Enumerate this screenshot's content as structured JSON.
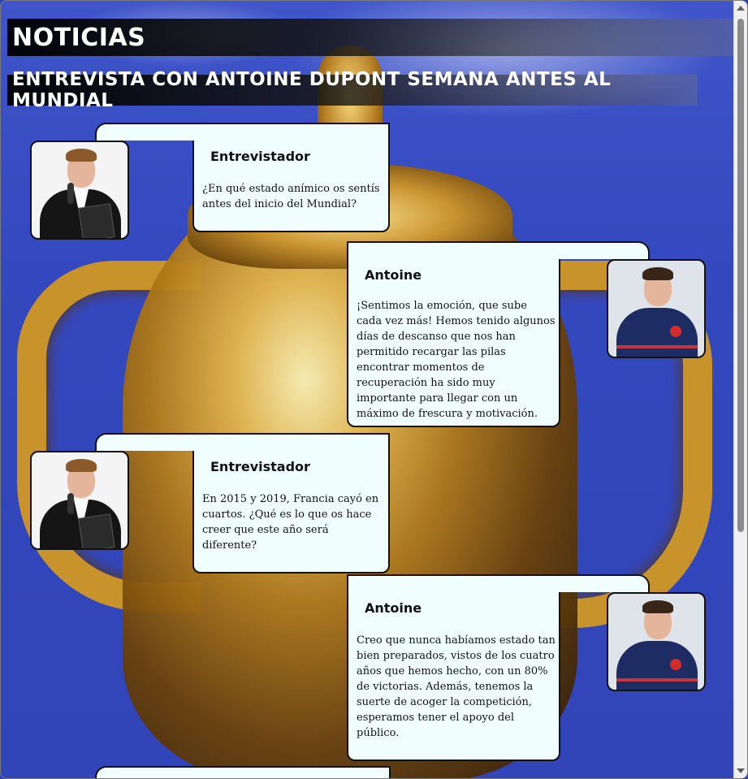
{
  "header": {
    "title": "NOTICIAS",
    "subtitle": "ENTREVISTA CON ANTOINE DUPONT SEMANA ANTES AL MUNDIAL"
  },
  "interview": [
    {
      "speaker": "Entrevistador",
      "avatar_icon": "interviewer-photo",
      "text": "¿En qué estado anímico os sentís antes del inicio del Mundial?"
    },
    {
      "speaker": "Antoine",
      "avatar_icon": "player-photo",
      "text": "¡Sentimos la emoción, que sube cada vez más! Hemos tenido algunos días de descanso que nos han permitido recargar las pilas encontrar momentos de recuperación ha sido muy importante para llegar con un máximo de frescura y motivación."
    },
    {
      "speaker": "Entrevistador",
      "avatar_icon": "interviewer-photo",
      "text": "En 2015 y 2019, Francia cayó en cuartos. ¿Qué es lo que os hace creer que este año será diferente?"
    },
    {
      "speaker": "Antoine",
      "avatar_icon": "player-photo",
      "text": "Creo que nunca habíamos estado tan bien preparados, vistos de los cuatro años que hemos hecho, con un 80% de victorias. Además, tenemos la suerte de acoger la competición, esperamos tener el apoyo del público."
    }
  ],
  "colors": {
    "bubble_bg": "#f0fffe",
    "background_blue": "#3448bf",
    "trophy_gold": "#c8932a"
  }
}
